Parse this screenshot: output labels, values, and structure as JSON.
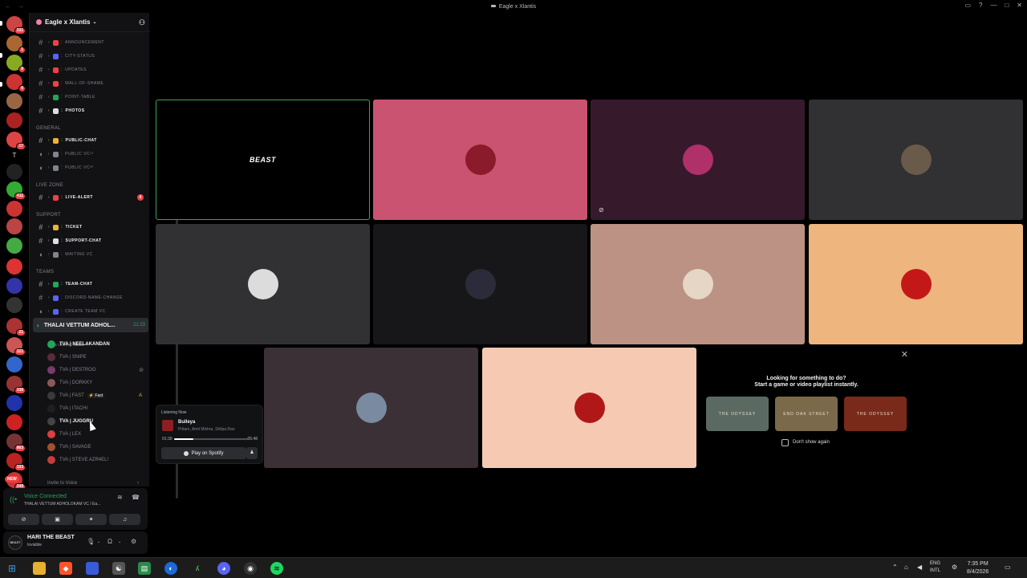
{
  "window": {
    "title": "Eagle x Xlantis",
    "nav_label": "← →"
  },
  "server_rail": {
    "badges": [
      "331",
      "1",
      "8",
      "6",
      "",
      "",
      "17",
      "",
      "",
      "411",
      "",
      "",
      "",
      "",
      "",
      "",
      "21",
      "321",
      "",
      "338",
      "",
      "",
      "863",
      "333",
      "249"
    ],
    "new_label": "NEW",
    "colors": {
      "badge": "#f23f43"
    }
  },
  "sidebar": {
    "server_name": "Eagle x Xlantis",
    "channels": [
      {
        "name": "ANNOUNCEMENT",
        "emoji_color": "#f23f43"
      },
      {
        "name": "CITY-STATUS",
        "emoji_color": "#5865f2"
      },
      {
        "name": "UPDATES",
        "emoji_color": "#f23f43"
      },
      {
        "name": "WALL-OF-SHAME",
        "emoji_color": "#f23f43"
      },
      {
        "name": "POINT-TABLE",
        "emoji_color": "#23a55a"
      },
      {
        "name": "PHOTOS",
        "emoji_color": "#dbdee1"
      }
    ],
    "category_general": "GENERAL",
    "general_channels": [
      {
        "name": "PUBLIC-CHAT"
      },
      {
        "name": "PUBLIC VC¹⁰"
      },
      {
        "name": "PUBLIC VC²⁰"
      }
    ],
    "category_live": "LIVE ZONE",
    "live_channels": [
      {
        "name": "LIVE-ALERT",
        "mention": "4"
      }
    ],
    "category_support": "SUPPORT",
    "support_channels": [
      {
        "name": "TICKET"
      },
      {
        "name": "SUPPORT-CHAT"
      },
      {
        "name": "WAITING VC"
      }
    ],
    "category_teams": "TEAMS",
    "team_channels": [
      {
        "name": "TEAM-CHAT"
      },
      {
        "name": "DISCORD-NAME-CHANGE"
      },
      {
        "name": "CREATE TEAM VC"
      }
    ],
    "voice_channel": {
      "name": "THALAI VETTUM ADHOL...",
      "time": "21:23",
      "status_hint": "Set a channel status ✎"
    },
    "members": [
      {
        "name": "TVA | NEELAKANDAN",
        "active": true,
        "color": "#23a55a"
      },
      {
        "name": "TVA | SNIPE",
        "color": "#5c2b3a"
      },
      {
        "name": "TVA | DESTROO",
        "color": "#7a3a6a"
      },
      {
        "name": "TVA | DORKKY",
        "color": "#8a5a5a"
      },
      {
        "name": "TVA | FAST",
        "extra": "⚡ Fast",
        "live": "A",
        "color": "#3a3a3a"
      },
      {
        "name": "TVA | ITACHI",
        "color": "#1e1f22"
      },
      {
        "name": "TVA | JUGGRU",
        "active": true,
        "color": "#444"
      },
      {
        "name": "TVA | LEX",
        "color": "#d94040"
      },
      {
        "name": "TVA | SAVAGE",
        "color": "#a0522d"
      },
      {
        "name": "TVA | STEVE AZR4EL!",
        "color": "#c43c3c"
      }
    ],
    "invite": "Invite to Voice"
  },
  "voice_panel": {
    "title": "Voice Connected",
    "subtitle": "THALAI VETTUM ADHOLOKAM VC / Ea..."
  },
  "user": {
    "name": "HARI THE BEAST",
    "status": "Invisible",
    "avatar_text": "BEAST"
  },
  "tiles": [
    {
      "label": "BEAST",
      "bg": "#000000",
      "border": "#3ba55d"
    },
    {
      "bg": "#c95371",
      "avatar": "#8b1a2a"
    },
    {
      "bg": "#361a2c",
      "avatar": "#b0306a",
      "muted": true
    },
    {
      "bg": "#313033",
      "avatar": "#6a5a4a"
    },
    {
      "bg": "#313033",
      "avatar": "#dcdcdc"
    },
    {
      "bg": "#17171a",
      "avatar": "#2b2b3a"
    },
    {
      "bg": "#bb9284",
      "avatar": "#e6d6c6"
    },
    {
      "bg": "#efb57f",
      "avatar": "#c41818"
    },
    {
      "bg": "#3a3036",
      "avatar": "#7a8aa0"
    },
    {
      "bg": "#f6cab2",
      "avatar": "#b01818"
    }
  ],
  "activity": {
    "line1": "Looking for something to do?",
    "line2": "Start a game or video playlist instantly.",
    "cards": [
      {
        "label": "THE ODYSSEY",
        "bg": "#5a6a62"
      },
      {
        "label": "END OAK STREET",
        "bg": "#7a6a4a"
      },
      {
        "label": "THE ODYSSEY",
        "bg": "#7a2a1a"
      }
    ],
    "dont_show": "Don't show again"
  },
  "spotify": {
    "header": "Listening Now",
    "song": "Bulleya",
    "artists": "Pritam, Amit Mishra, Shilpa Rao",
    "time_elapsed": "01:30",
    "time_total": "05:48",
    "progress": 0.26,
    "button": "Play on Spotify"
  },
  "taskbar": {
    "lang_top": "ENG",
    "lang_bottom": "INTL",
    "time": "7:35 PM",
    "date": "8/4/2026"
  }
}
